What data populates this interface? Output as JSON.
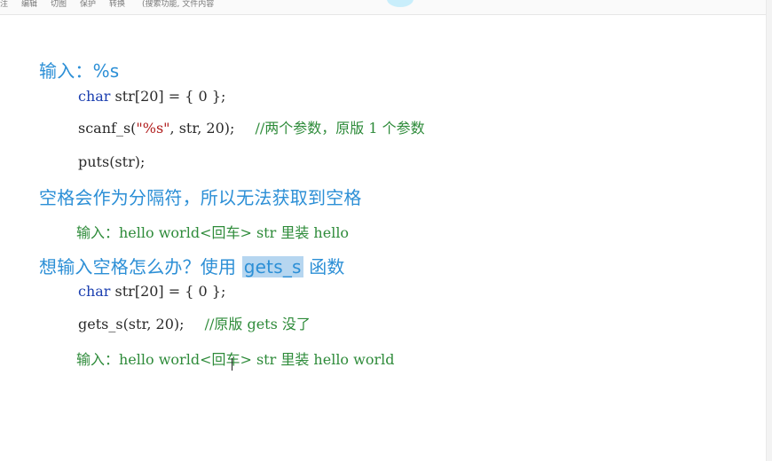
{
  "toolbar": {
    "items": [
      "注",
      "编辑",
      "切图",
      "保护",
      "转换"
    ],
    "search_hint": "(搜索功能, 文件内容"
  },
  "section1": {
    "heading": "输入：%s",
    "decl_kw": "char",
    "decl_rest": " str[20] = { 0 };",
    "scanf_pre": "scanf_s(",
    "scanf_str": "\"%s\"",
    "scanf_post": ", str, 20);",
    "scanf_comment": "//两个参数，原版 1 个参数",
    "puts": "puts(str);"
  },
  "section2": {
    "heading": "空格会作为分隔符，所以无法获取到空格",
    "note": "输入：hello world<回车>    str 里装 hello"
  },
  "section3": {
    "heading_pre": "想输入空格怎么办？使用 ",
    "heading_hl": "gets_s",
    "heading_post": " 函数",
    "decl_kw": "char",
    "decl_rest": " str[20] = { 0 };",
    "gets_code": "gets_s(str, 20);",
    "gets_comment": "//原版 gets 没了",
    "note": "输入：hello world<回车>    str 里装 hello world"
  }
}
